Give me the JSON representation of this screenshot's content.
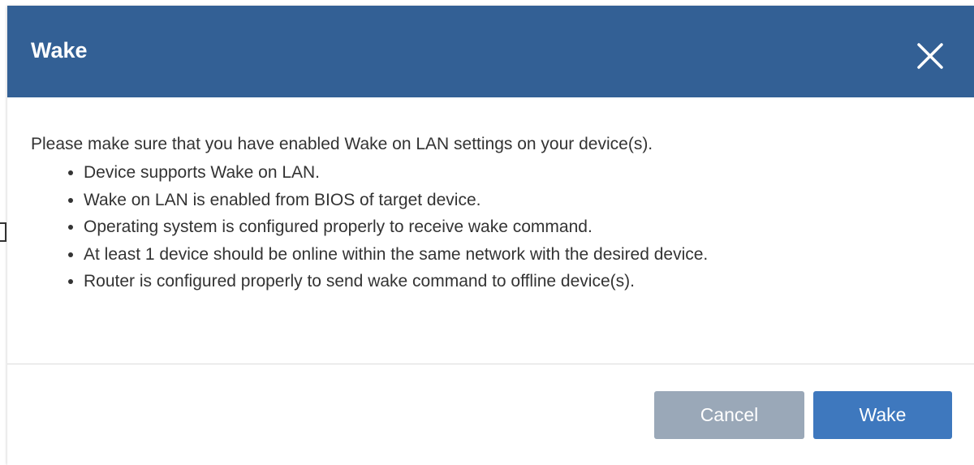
{
  "dialog": {
    "title": "Wake",
    "intro": "Please make sure that you have enabled Wake on LAN settings on your device(s).",
    "requirements": [
      "Device supports Wake on LAN.",
      "Wake on LAN is enabled from BIOS of target device.",
      "Operating system is configured properly to receive wake command.",
      "At least 1 device should be online within the same network with the desired device.",
      "Router is configured properly to send wake command to offline device(s)."
    ],
    "buttons": {
      "cancel": "Cancel",
      "wake": "Wake"
    },
    "icons": {
      "close": "close-icon"
    }
  },
  "colors": {
    "header": "#336095",
    "primary_button": "#3e78be",
    "secondary_button": "#9aa8b8",
    "text": "#333333"
  }
}
